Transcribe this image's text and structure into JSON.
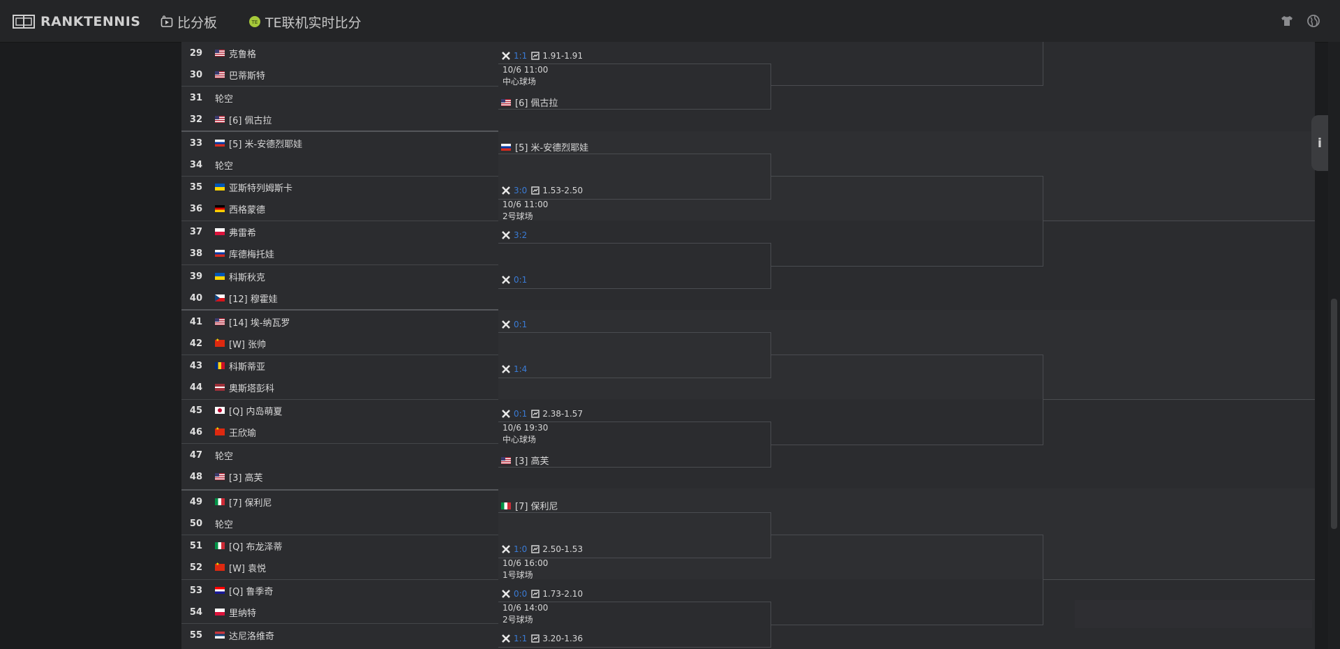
{
  "header": {
    "logo_text": "RANKTENNIS",
    "nav": [
      {
        "label": "比分板",
        "icon": "scoreboard-icon"
      },
      {
        "label": "TE联机实时比分",
        "icon": "tennis-ball-icon"
      }
    ],
    "right_icons": [
      "shirt-icon",
      "globe-icon"
    ]
  },
  "side_tab": {
    "label": "i"
  },
  "draw": {
    "rows": [
      {
        "seed": "29",
        "flag": "us",
        "name": "克鲁格"
      },
      {
        "seed": "30",
        "flag": "us",
        "name": "巴蒂斯特"
      },
      {
        "seed": "31",
        "flag": "",
        "name": "轮空"
      },
      {
        "seed": "32",
        "flag": "us",
        "name": "[6] 佩古拉"
      },
      {
        "seed": "33",
        "flag": "ru",
        "name": "[5] 米-安德烈耶娃"
      },
      {
        "seed": "34",
        "flag": "",
        "name": "轮空"
      },
      {
        "seed": "35",
        "flag": "ua",
        "name": "亚斯特列姆斯卡"
      },
      {
        "seed": "36",
        "flag": "de",
        "name": "西格蒙德"
      },
      {
        "seed": "37",
        "flag": "pl",
        "name": "弗雷希"
      },
      {
        "seed": "38",
        "flag": "ru",
        "name": "库德梅托娃"
      },
      {
        "seed": "39",
        "flag": "ua",
        "name": "科斯秋克"
      },
      {
        "seed": "40",
        "flag": "cz",
        "name": "[12] 穆霍娃"
      },
      {
        "seed": "41",
        "flag": "us",
        "name": "[14] 埃-纳瓦罗"
      },
      {
        "seed": "42",
        "flag": "cn",
        "name": "[W] 张帅"
      },
      {
        "seed": "43",
        "flag": "ro",
        "name": "科斯蒂亚"
      },
      {
        "seed": "44",
        "flag": "lv",
        "name": "奥斯塔彭科"
      },
      {
        "seed": "45",
        "flag": "jp",
        "name": "[Q] 内岛萌夏"
      },
      {
        "seed": "46",
        "flag": "cn",
        "name": "王欣瑜"
      },
      {
        "seed": "47",
        "flag": "",
        "name": "轮空"
      },
      {
        "seed": "48",
        "flag": "us",
        "name": "[3] 高芙"
      },
      {
        "seed": "49",
        "flag": "it",
        "name": "[7] 保利尼"
      },
      {
        "seed": "50",
        "flag": "",
        "name": "轮空"
      },
      {
        "seed": "51",
        "flag": "it",
        "name": "[Q] 布龙泽蒂"
      },
      {
        "seed": "52",
        "flag": "cn",
        "name": "[W] 袁悦"
      },
      {
        "seed": "53",
        "flag": "hr",
        "name": "[Q] 鲁季奇"
      },
      {
        "seed": "54",
        "flag": "pl",
        "name": "里纳特"
      },
      {
        "seed": "55",
        "flag": "rs",
        "name": "达尼洛维奇"
      }
    ],
    "matches": [
      {
        "h2h": "1:1",
        "odds": "1.91-1.91",
        "time": "10/6 11:00",
        "court": "中心球场"
      },
      {
        "h2h": "3:0",
        "odds": "1.53-2.50",
        "time": "10/6 11:00",
        "court": "2号球场"
      },
      {
        "h2h": "3:2",
        "odds": "",
        "time": "",
        "court": ""
      },
      {
        "h2h": "0:1",
        "odds": "",
        "time": "",
        "court": ""
      },
      {
        "h2h": "0:1",
        "odds": "",
        "time": "",
        "court": ""
      },
      {
        "h2h": "1:4",
        "odds": "",
        "time": "",
        "court": ""
      },
      {
        "h2h": "0:1",
        "odds": "2.38-1.57",
        "time": "10/6 19:30",
        "court": "中心球场"
      },
      {
        "h2h": "1:0",
        "odds": "2.50-1.53",
        "time": "10/6 16:00",
        "court": "1号球场"
      },
      {
        "h2h": "0:0",
        "odds": "1.73-2.10",
        "time": "10/6 14:00",
        "court": "2号球场"
      },
      {
        "h2h": "1:1",
        "odds": "3.20-1.36",
        "time": "",
        "court": ""
      }
    ],
    "advancers": [
      {
        "flag": "us",
        "name": "[6] 佩古拉"
      },
      {
        "flag": "ru",
        "name": "[5] 米-安德烈耶娃"
      },
      {
        "flag": "us",
        "name": "[3] 高芙"
      },
      {
        "flag": "it",
        "name": "[7] 保利尼"
      }
    ]
  }
}
